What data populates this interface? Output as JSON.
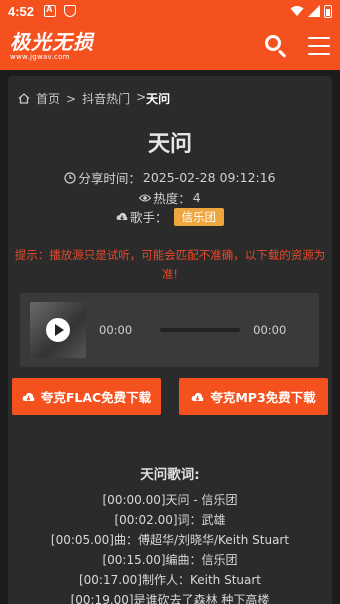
{
  "status_bar": {
    "time": "4:52"
  },
  "header": {
    "logo_main": "极光无损",
    "logo_sub": "www.jgwav.com"
  },
  "breadcrumb": {
    "home": "首页",
    "sep1": ">",
    "category": "抖音热门",
    "sep2": ">",
    "current": "天问"
  },
  "song": {
    "title": "天问",
    "share_label": "分享时间：",
    "share_time": "2025-02-28 09:12:16",
    "heat_label": "热度：",
    "heat_value": "4",
    "singer_label": "歌手：",
    "singer": "信乐团"
  },
  "notice": "提示：播放源只是试听，可能会匹配不准确，以下载的资源为准!",
  "player": {
    "current_time": "00:00",
    "duration": "00:00",
    "progress": 0
  },
  "downloads": {
    "flac_label": "夸克FLAC免费下载",
    "mp3_label": "夸克MP3免费下载"
  },
  "lyrics": {
    "title": "天问歌词:",
    "lines": [
      "[00:00.00]天问 - 信乐团",
      "[00:02.00]词：武雄",
      "[00:05.00]曲：傅超华/刘晓华/Keith Stuart",
      "[00:15.00]编曲：信乐团",
      "[00:17.00]制作人：Keith Stuart",
      "[00:19.00]是谁砍去了森林 种下高楼"
    ]
  },
  "colors": {
    "accent": "#f4511e",
    "singer_tag": "#f0a63e",
    "notice": "#e8492a",
    "background": "#1c1c1c",
    "card": "#2b2b2b"
  }
}
